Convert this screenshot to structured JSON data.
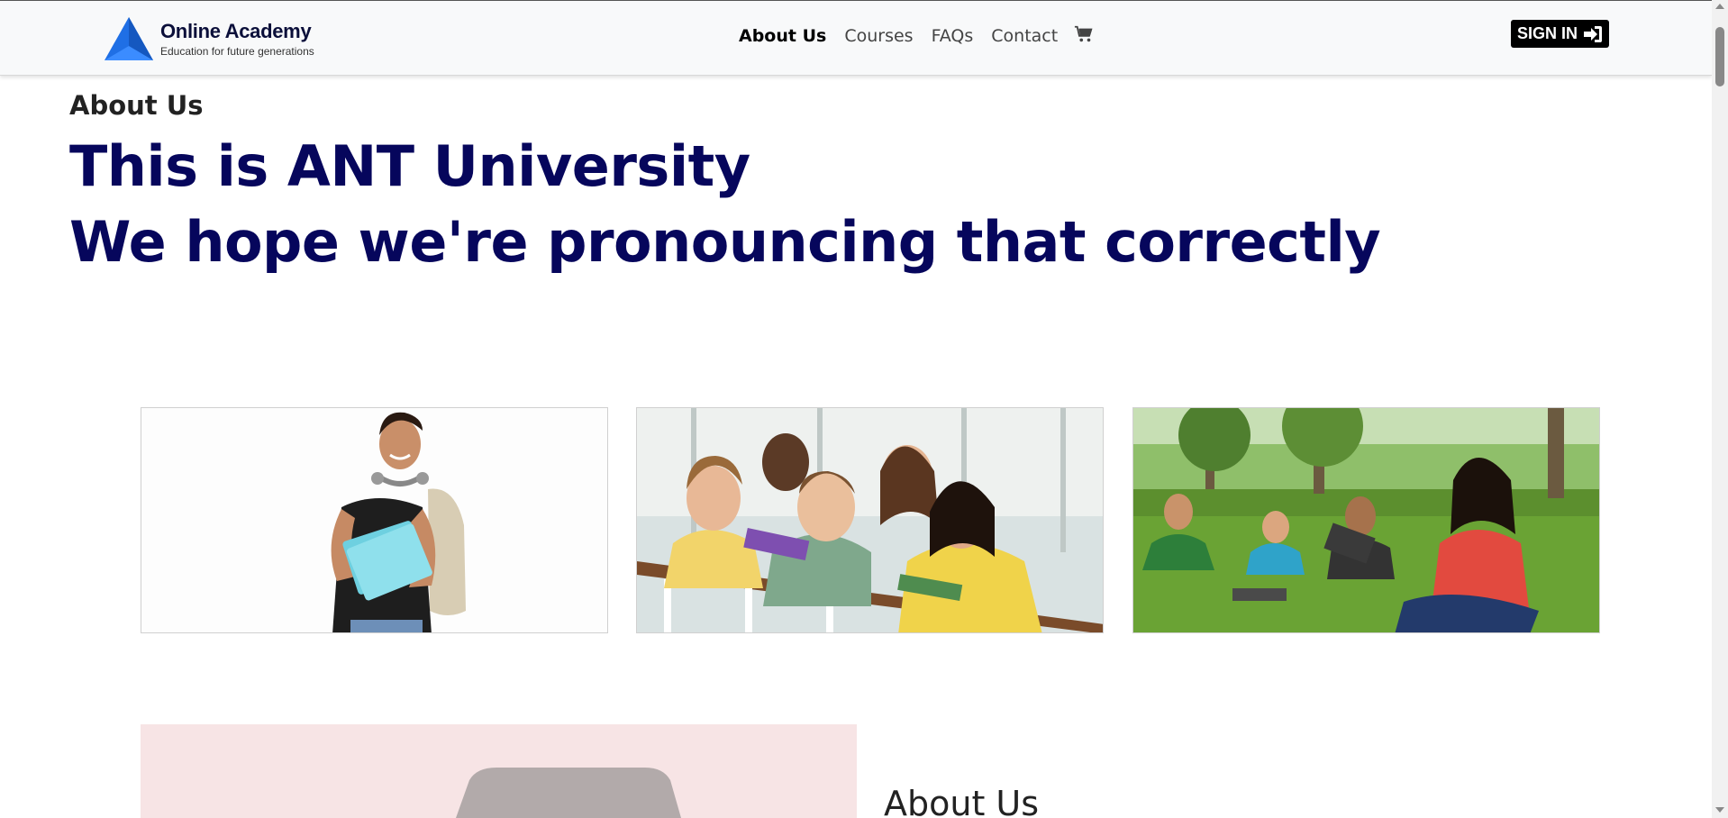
{
  "brand": {
    "name": "Online Academy",
    "tagline": "Education for future generations"
  },
  "nav": {
    "links": [
      {
        "label": "About Us",
        "active": true
      },
      {
        "label": "Courses",
        "active": false
      },
      {
        "label": "FAQs",
        "active": false
      },
      {
        "label": "Contact",
        "active": false
      }
    ],
    "cart_icon": "shopping-cart-icon",
    "signin_label": "SIGN IN",
    "signin_icon": "sign-in-arrow-icon"
  },
  "hero": {
    "section_label": "About Us",
    "headline_line1": "This is ANT University",
    "headline_line2": "We hope we're pronouncing that correctly"
  },
  "photos": [
    {
      "alt": "Student with notebooks and headphones"
    },
    {
      "alt": "Group of smiling students leaning on railing"
    },
    {
      "alt": "Students sitting on grass with laptops"
    }
  ],
  "lower": {
    "title": "About Us"
  },
  "colors": {
    "headline": "#06065c",
    "nav_bg": "#f8f9fa",
    "logo_blue": "#1a73e8",
    "signin_bg": "#000000",
    "lower_bg": "#f7e4e5"
  }
}
